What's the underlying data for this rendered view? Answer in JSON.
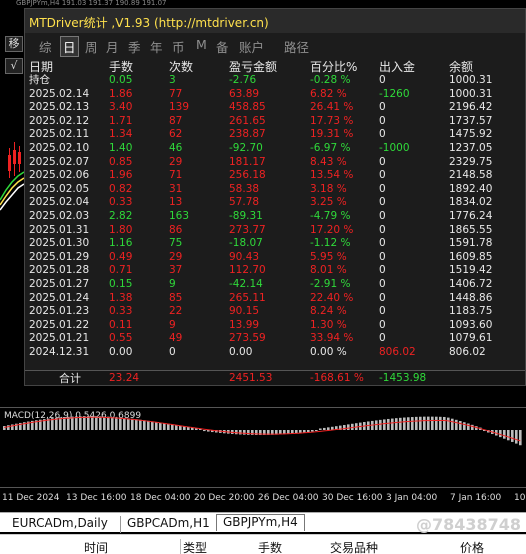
{
  "chart": {
    "top_strip": "GBPJPYm,H4 191.03 191.37 190.89 191.07",
    "side_buttons": [
      "移",
      "√"
    ]
  },
  "overlay": {
    "title": "MTDriver统计 ,V1.93 (http://mtdriver.cn)",
    "tabs": [
      "综",
      "日",
      "周",
      "月",
      "季",
      "年",
      "币",
      "M",
      "备",
      "账户",
      "路径"
    ],
    "active_tab": "日",
    "headers": [
      "日期",
      "手数",
      "次数",
      "盈亏金额",
      "百分比%",
      "出入金",
      "余额"
    ],
    "rows": [
      {
        "date": "持仓",
        "lots": "0.05",
        "count": "3",
        "pl": "-2.76",
        "pct": "-0.28 %",
        "flow": "0",
        "balance": "1000.31",
        "tone": "green"
      },
      {
        "date": "2025.02.14",
        "lots": "1.86",
        "count": "77",
        "pl": "63.89",
        "pct": "6.82 %",
        "flow": "-1260",
        "balance": "1000.31",
        "tone": "red"
      },
      {
        "date": "2025.02.13",
        "lots": "3.40",
        "count": "139",
        "pl": "458.85",
        "pct": "26.41 %",
        "flow": "0",
        "balance": "2196.42",
        "tone": "red"
      },
      {
        "date": "2025.02.12",
        "lots": "1.71",
        "count": "87",
        "pl": "261.65",
        "pct": "17.73 %",
        "flow": "0",
        "balance": "1737.57",
        "tone": "red"
      },
      {
        "date": "2025.02.11",
        "lots": "1.34",
        "count": "62",
        "pl": "238.87",
        "pct": "19.31 %",
        "flow": "0",
        "balance": "1475.92",
        "tone": "red"
      },
      {
        "date": "2025.02.10",
        "lots": "1.40",
        "count": "46",
        "pl": "-92.70",
        "pct": "-6.97 %",
        "flow": "-1000",
        "balance": "1237.05",
        "tone": "green"
      },
      {
        "date": "2025.02.07",
        "lots": "0.85",
        "count": "29",
        "pl": "181.17",
        "pct": "8.43 %",
        "flow": "0",
        "balance": "2329.75",
        "tone": "red"
      },
      {
        "date": "2025.02.06",
        "lots": "1.96",
        "count": "71",
        "pl": "256.18",
        "pct": "13.54 %",
        "flow": "0",
        "balance": "2148.58",
        "tone": "red"
      },
      {
        "date": "2025.02.05",
        "lots": "0.82",
        "count": "31",
        "pl": "58.38",
        "pct": "3.18 %",
        "flow": "0",
        "balance": "1892.40",
        "tone": "red"
      },
      {
        "date": "2025.02.04",
        "lots": "0.33",
        "count": "13",
        "pl": "57.78",
        "pct": "3.25 %",
        "flow": "0",
        "balance": "1834.02",
        "tone": "red"
      },
      {
        "date": "2025.02.03",
        "lots": "2.82",
        "count": "163",
        "pl": "-89.31",
        "pct": "-4.79 %",
        "flow": "0",
        "balance": "1776.24",
        "tone": "green"
      },
      {
        "date": "2025.01.31",
        "lots": "1.80",
        "count": "86",
        "pl": "273.77",
        "pct": "17.20 %",
        "flow": "0",
        "balance": "1865.55",
        "tone": "red"
      },
      {
        "date": "2025.01.30",
        "lots": "1.16",
        "count": "75",
        "pl": "-18.07",
        "pct": "-1.12 %",
        "flow": "0",
        "balance": "1591.78",
        "tone": "green"
      },
      {
        "date": "2025.01.29",
        "lots": "0.49",
        "count": "29",
        "pl": "90.43",
        "pct": "5.95 %",
        "flow": "0",
        "balance": "1609.85",
        "tone": "red"
      },
      {
        "date": "2025.01.28",
        "lots": "0.71",
        "count": "37",
        "pl": "112.70",
        "pct": "8.01 %",
        "flow": "0",
        "balance": "1519.42",
        "tone": "red"
      },
      {
        "date": "2025.01.27",
        "lots": "0.15",
        "count": "9",
        "pl": "-42.14",
        "pct": "-2.91 %",
        "flow": "0",
        "balance": "1406.72",
        "tone": "green"
      },
      {
        "date": "2025.01.24",
        "lots": "1.38",
        "count": "85",
        "pl": "265.11",
        "pct": "22.40 %",
        "flow": "0",
        "balance": "1448.86",
        "tone": "red"
      },
      {
        "date": "2025.01.23",
        "lots": "0.33",
        "count": "22",
        "pl": "90.15",
        "pct": "8.24 %",
        "flow": "0",
        "balance": "1183.75",
        "tone": "red"
      },
      {
        "date": "2025.01.22",
        "lots": "0.11",
        "count": "9",
        "pl": "13.99",
        "pct": "1.30 %",
        "flow": "0",
        "balance": "1093.60",
        "tone": "red"
      },
      {
        "date": "2025.01.21",
        "lots": "0.55",
        "count": "49",
        "pl": "273.59",
        "pct": "33.94 %",
        "flow": "0",
        "balance": "1079.61",
        "tone": "red"
      },
      {
        "date": "2024.12.31",
        "lots": "0.00",
        "count": "0",
        "pl": "0.00",
        "pct": "0.00 %",
        "flow": "806.02",
        "balance": "806.02",
        "tone": "plain"
      }
    ],
    "totals": {
      "label": "合计",
      "lots": "23.24",
      "pl": "2451.53",
      "pct": "-168.61 %",
      "flow": "-1453.98"
    }
  },
  "macd": {
    "label": "MACD(12,26,9) 0.5426 0.6899"
  },
  "time_axis": [
    "11 Dec 2024",
    "13 Dec 16:00",
    "18 Dec 04:00",
    "20 Dec 20:00",
    "26 Dec 04:00",
    "30 Dec 16:00",
    "3 Jan 04:00",
    "7 Jan 16:00",
    "10"
  ],
  "symbol_tabs": [
    "EURCADm,Daily",
    "GBPCADm,H1",
    "GBPJPYm,H4"
  ],
  "active_symbol": "GBPJPYm,H4",
  "watermark": "@78438748",
  "terminal_headers": [
    "时间",
    "类型",
    "手数",
    "交易品种",
    "价格"
  ],
  "colors": {
    "title_yellow": "#ffe14d",
    "green": "#2fd93a",
    "red": "#ee2222",
    "macd_line": "#ee2222",
    "macd_bars": "#bdbdbd"
  }
}
